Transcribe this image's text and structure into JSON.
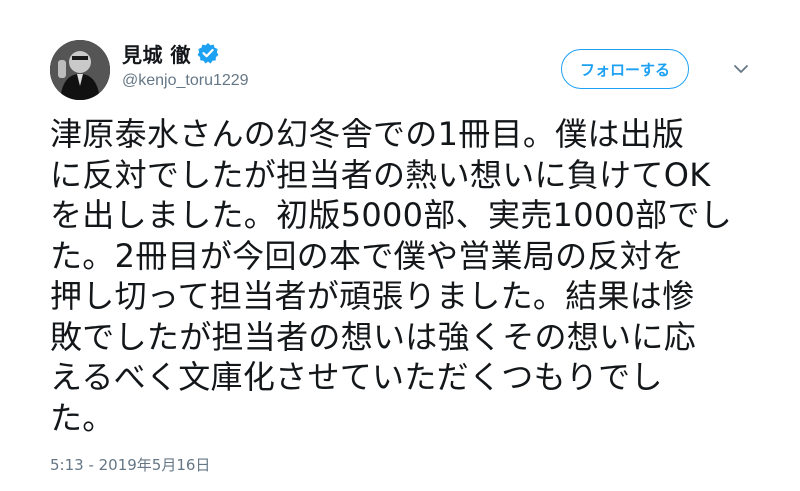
{
  "author": {
    "display_name": "見城 徹",
    "handle": "@kenjo_toru1229",
    "verified": true,
    "avatar_icon": "profile-photo"
  },
  "actions": {
    "follow_label": "フォローする",
    "menu_icon": "chevron-down-icon"
  },
  "tweet": {
    "text_lines": [
      "津原泰水さんの幻冬舎での1冊目。僕は出版",
      "に反対でしたが担当者の熱い想いに負けてOK",
      "を出しました。初版5000部、実売1000部でし",
      "た。2冊目が今回の本で僕や営業局の反対を",
      "押し切って担当者が頑張りました。結果は惨",
      "敗でしたが担当者の想いは強くその想いに応",
      "えるべく文庫化させていただくつもりでし",
      "た。"
    ],
    "timestamp": "5:13 - 2019年5月16日"
  },
  "colors": {
    "accent": "#1da1f2",
    "text": "#14171a",
    "secondary": "#657786"
  }
}
